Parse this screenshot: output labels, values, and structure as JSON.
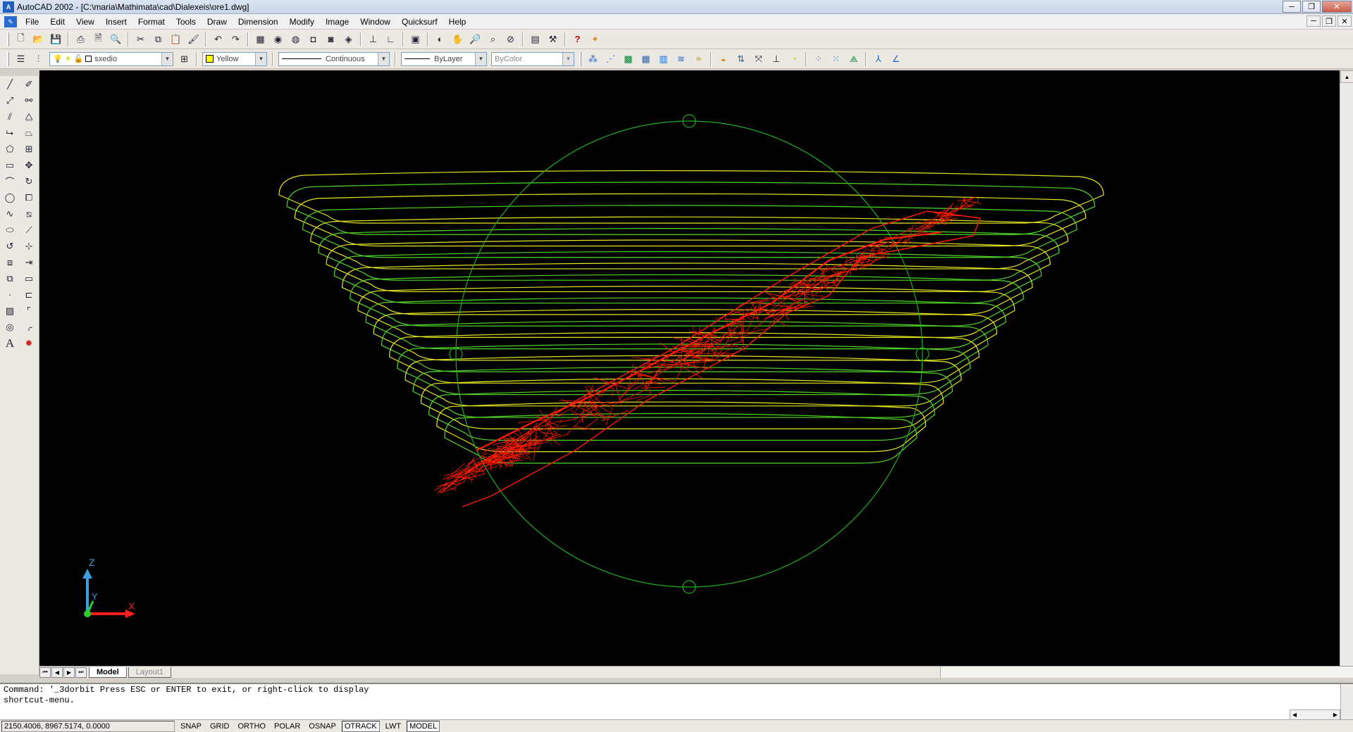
{
  "window": {
    "title": "AutoCAD 2002 - [C:\\maria\\Mathimata\\cad\\Dialexeis\\ore1.dwg]",
    "minimize_glyph": "─",
    "restore_glyph": "❐",
    "close_glyph": "✕"
  },
  "menu": [
    "File",
    "Edit",
    "View",
    "Insert",
    "Format",
    "Tools",
    "Draw",
    "Dimension",
    "Modify",
    "Image",
    "Window",
    "Quicksurf",
    "Help"
  ],
  "properties": {
    "layer": "sxedio",
    "color_name": "Yellow",
    "color_hex": "#ffff00",
    "linetype": "Continuous",
    "lineweight": "ByLayer",
    "plotstyle": "ByColor"
  },
  "ucs": {
    "z": "Z",
    "y": "Y",
    "x": "X"
  },
  "tabs": {
    "model": "Model",
    "layout": "Layout1"
  },
  "command": {
    "line1": "Command: '_3dorbit Press ESC or ENTER to exit, or right-click to display",
    "line2": "shortcut-menu."
  },
  "status": {
    "coords": "2150.4006, 8967.5174, 0.0000",
    "buttons": [
      {
        "label": "SNAP",
        "on": false
      },
      {
        "label": "GRID",
        "on": false
      },
      {
        "label": "ORTHO",
        "on": false
      },
      {
        "label": "POLAR",
        "on": false
      },
      {
        "label": "OSNAP",
        "on": false
      },
      {
        "label": "OTRACK",
        "on": true
      },
      {
        "label": "LWT",
        "on": false
      },
      {
        "label": "MODEL",
        "on": true
      }
    ]
  },
  "colors": {
    "background": "#000000",
    "orbit_circle": "#1fae1f",
    "contour_yellow": "#e6e620",
    "contour_green": "#4fd826",
    "orebody": "#ff1a00"
  }
}
